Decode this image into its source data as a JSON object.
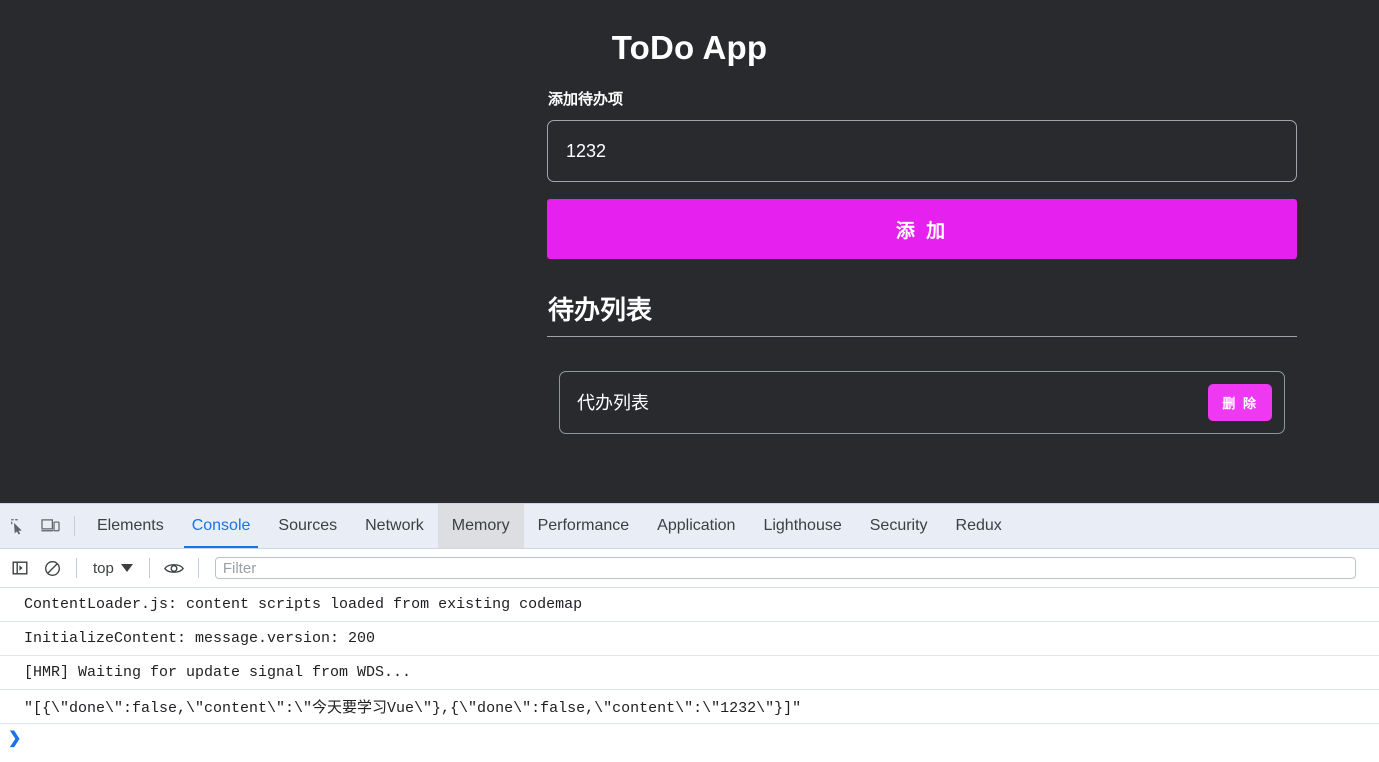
{
  "app": {
    "title": "ToDo App",
    "add_section": {
      "label": "添加待办项",
      "input_value": "1232",
      "input_placeholder": "",
      "add_button_label": "添 加"
    },
    "list_section": {
      "heading": "待办列表",
      "items": [
        {
          "text": "代办列表",
          "delete_label": "删 除"
        }
      ]
    },
    "colors": {
      "background": "#282A2E",
      "accent": "#E620EE",
      "accent_light": "#EE38F2",
      "border": "#9FA3A9",
      "text": "#FFFFFF"
    }
  },
  "devtools": {
    "left_icons": [
      {
        "name": "inspect-element-icon"
      },
      {
        "name": "device-toolbar-icon"
      }
    ],
    "tabs": [
      {
        "label": "Elements",
        "state": "normal"
      },
      {
        "label": "Console",
        "state": "active"
      },
      {
        "label": "Sources",
        "state": "normal"
      },
      {
        "label": "Network",
        "state": "normal"
      },
      {
        "label": "Memory",
        "state": "hovered"
      },
      {
        "label": "Performance",
        "state": "normal"
      },
      {
        "label": "Application",
        "state": "normal"
      },
      {
        "label": "Lighthouse",
        "state": "normal"
      },
      {
        "label": "Security",
        "state": "normal"
      },
      {
        "label": "Redux",
        "state": "normal"
      }
    ],
    "toolbar": {
      "sidebar_toggle_icon": "show-console-sidebar-icon",
      "clear_console_icon": "clear-console-icon",
      "context_label": "top",
      "eye_icon": "live-expression-eye-icon",
      "filter_placeholder": "Filter",
      "filter_value": ""
    },
    "console_messages": [
      "ContentLoader.js: content scripts loaded from existing codemap",
      "InitializeContent: message.version: 200",
      "[HMR] Waiting for update signal from WDS...",
      "\"[{\\\"done\\\":false,\\\"content\\\":\\\"今天要学习Vue\\\"},{\\\"done\\\":false,\\\"content\\\":\\\"1232\\\"}]\""
    ],
    "prompt": {
      "chevron": "❯",
      "value": ""
    },
    "colors": {
      "tabbar_bg": "#E9EEF6",
      "active_tab": "#1A73E8",
      "row_divider": "#DCE7F5"
    }
  }
}
